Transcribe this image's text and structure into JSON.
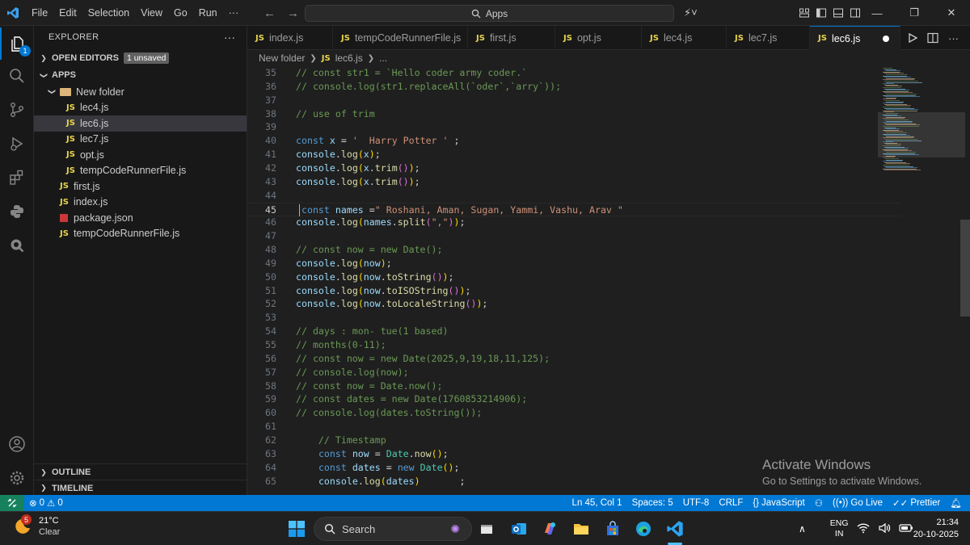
{
  "menu": [
    "File",
    "Edit",
    "Selection",
    "View",
    "Go",
    "Run"
  ],
  "command_center": {
    "text": "Apps"
  },
  "sidebar": {
    "title": "EXPLORER",
    "open_editors": {
      "label": "OPEN EDITORS",
      "badge": "1 unsaved"
    },
    "root": "APPS",
    "folder": "New folder",
    "folder_files": [
      "lec4.js",
      "lec6.js",
      "lec7.js",
      "opt.js",
      "tempCodeRunnerFile.js"
    ],
    "root_files": [
      "first.js",
      "index.js",
      "package.json",
      "tempCodeRunnerFile.js"
    ],
    "outline": "OUTLINE",
    "timeline": "TIMELINE"
  },
  "tabs": [
    "index.js",
    "tempCodeRunnerFile.js",
    "first.js",
    "opt.js",
    "lec4.js",
    "lec7.js",
    "lec6.js"
  ],
  "breadcrumb": {
    "folder": "New folder",
    "file": "lec6.js",
    "more": "..."
  },
  "file_badge": "JS",
  "code": [
    {
      "n": "35",
      "t": "// const str1 = `Hello coder army coder.`"
    },
    {
      "n": "36",
      "t": "// console.log(str1.replaceAll(`oder`,`arry`));"
    },
    {
      "n": "37",
      "t": ""
    },
    {
      "n": "38",
      "t": "// use of trim"
    },
    {
      "n": "39",
      "t": ""
    },
    {
      "n": "40",
      "t": "const x = '  Harry Potter ' ;"
    },
    {
      "n": "41",
      "t": "console.log(x);"
    },
    {
      "n": "42",
      "t": "console.log(x.trim());"
    },
    {
      "n": "43",
      "t": "console.log(x.trim());"
    },
    {
      "n": "44",
      "t": ""
    },
    {
      "n": "45",
      "t": " const names =\" Roshani, Aman, Sugan, Yammi, Vashu, Arav \""
    },
    {
      "n": "46",
      "t": "console.log(names.split(\",\"));"
    },
    {
      "n": "47",
      "t": ""
    },
    {
      "n": "48",
      "t": "// const now = new Date();"
    },
    {
      "n": "49",
      "t": "console.log(now);"
    },
    {
      "n": "50",
      "t": "console.log(now.toString());"
    },
    {
      "n": "51",
      "t": "console.log(now.toISOString());"
    },
    {
      "n": "52",
      "t": "console.log(now.toLocaleString());"
    },
    {
      "n": "53",
      "t": ""
    },
    {
      "n": "54",
      "t": "// days : mon- tue(1 based)"
    },
    {
      "n": "55",
      "t": "// months(0-11);"
    },
    {
      "n": "56",
      "t": "// const now = new Date(2025,9,19,18,11,125);"
    },
    {
      "n": "57",
      "t": "// console.log(now);"
    },
    {
      "n": "58",
      "t": "// const now = Date.now();"
    },
    {
      "n": "59",
      "t": "// const dates = new Date(1760853214906);"
    },
    {
      "n": "60",
      "t": "// console.log(dates.toString());"
    },
    {
      "n": "61",
      "t": ""
    },
    {
      "n": "62",
      "t": "    // Timestamp"
    },
    {
      "n": "63",
      "t": "    const now = Date.now();"
    },
    {
      "n": "64",
      "t": "    const dates = new Date();"
    },
    {
      "n": "65",
      "t": "    console.log(dates)       ;"
    }
  ],
  "watermark": {
    "title": "Activate Windows",
    "subtitle": "Go to Settings to activate Windows."
  },
  "status": {
    "errors": "0",
    "warnings": "0",
    "position": "Ln 45, Col 1",
    "spaces": "Spaces: 5",
    "encoding": "UTF-8",
    "eol": "CRLF",
    "language": "JavaScript",
    "golive": "Go Live",
    "prettier": "Prettier"
  },
  "taskbar": {
    "temp": "21°C",
    "weather": "Clear",
    "weather_badge": "5",
    "search": "Search",
    "lang1": "ENG",
    "lang2": "IN",
    "time": "21:34",
    "date": "20-10-2025"
  }
}
